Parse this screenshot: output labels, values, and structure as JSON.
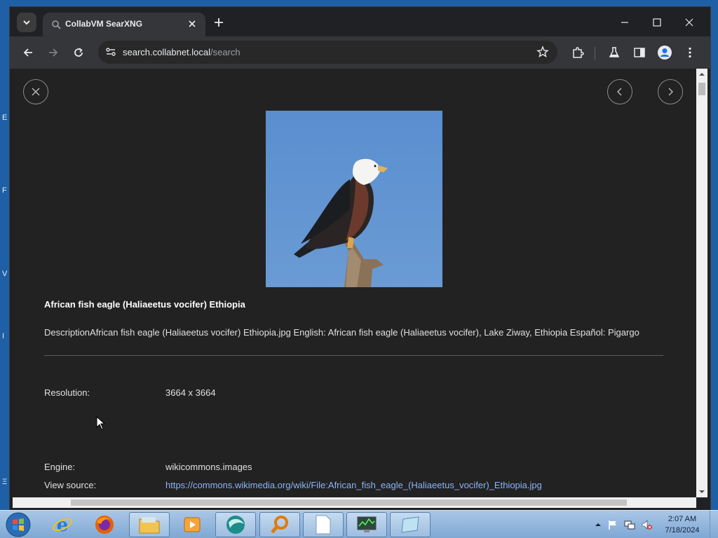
{
  "desktop": {
    "side_letters": [
      "E",
      "F",
      "V",
      "I",
      "Ξ"
    ]
  },
  "tab": {
    "title": "CollabVM SearXNG"
  },
  "window_controls": {
    "minimize": "—",
    "maximize": "☐",
    "close": "✕"
  },
  "omnibox": {
    "host": "search.collabnet.local",
    "path": "/search"
  },
  "image_detail": {
    "title": "African fish eagle (Haliaeetus vocifer) Ethiopia",
    "description": "DescriptionAfrican fish eagle (Haliaeetus vocifer) Ethiopia.jpg English: African fish eagle (Haliaeetus vocifer), Lake Ziway, Ethiopia Español: Pigargo",
    "resolution_label": "Resolution:",
    "resolution_value": "3664 x 3664",
    "engine_label": "Engine:",
    "engine_value": "wikicommons.images",
    "source_label": "View source:",
    "source_url": "https://commons.wikimedia.org/wiki/File:African_fish_eagle_(Haliaeetus_vocifer)_Ethiopia.jpg"
  },
  "taskbar": {
    "time": "2:07 AM",
    "date": "7/18/2024"
  },
  "colors": {
    "page_bg": "#222222",
    "link": "#8ab4f8",
    "sky": "#5b8fce"
  }
}
